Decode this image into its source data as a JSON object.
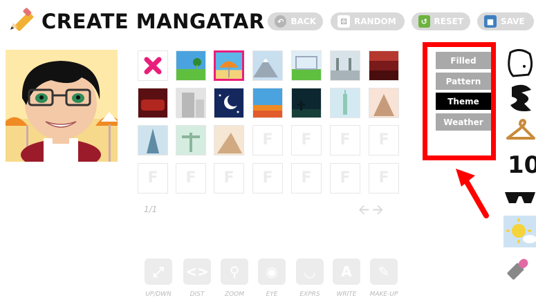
{
  "header": {
    "title": "CREATE MANGATAR",
    "buttons": [
      {
        "label": "BACK",
        "icon": "back-arrow-icon"
      },
      {
        "label": "RANDOM",
        "icon": "dice-icon"
      },
      {
        "label": "RESET",
        "icon": "reset-icon"
      },
      {
        "label": "SAVE",
        "icon": "floppy-disk-icon"
      }
    ]
  },
  "grid": {
    "page_indicator": "1/1",
    "selected_index": 2
  },
  "menu": {
    "items": [
      "Filled",
      "Pattern",
      "Theme",
      "Weather"
    ],
    "active": "Theme",
    "highlight_color": "#ff0000"
  },
  "toolbar": {
    "items": [
      "UP/DWN",
      "DIST",
      "ZOOM",
      "EYE",
      "EXPRS",
      "WRITE",
      "MAKE-UP"
    ]
  },
  "side_icons": [
    "face-icon",
    "hair-icon",
    "clothes-hanger-icon",
    "number-icon",
    "sunglasses-icon",
    "weather-icon",
    "lipstick-icon"
  ],
  "colors": {
    "accent": "#e91e7a",
    "menu_active": "#000000",
    "menu_inactive": "#a9a9a9"
  }
}
